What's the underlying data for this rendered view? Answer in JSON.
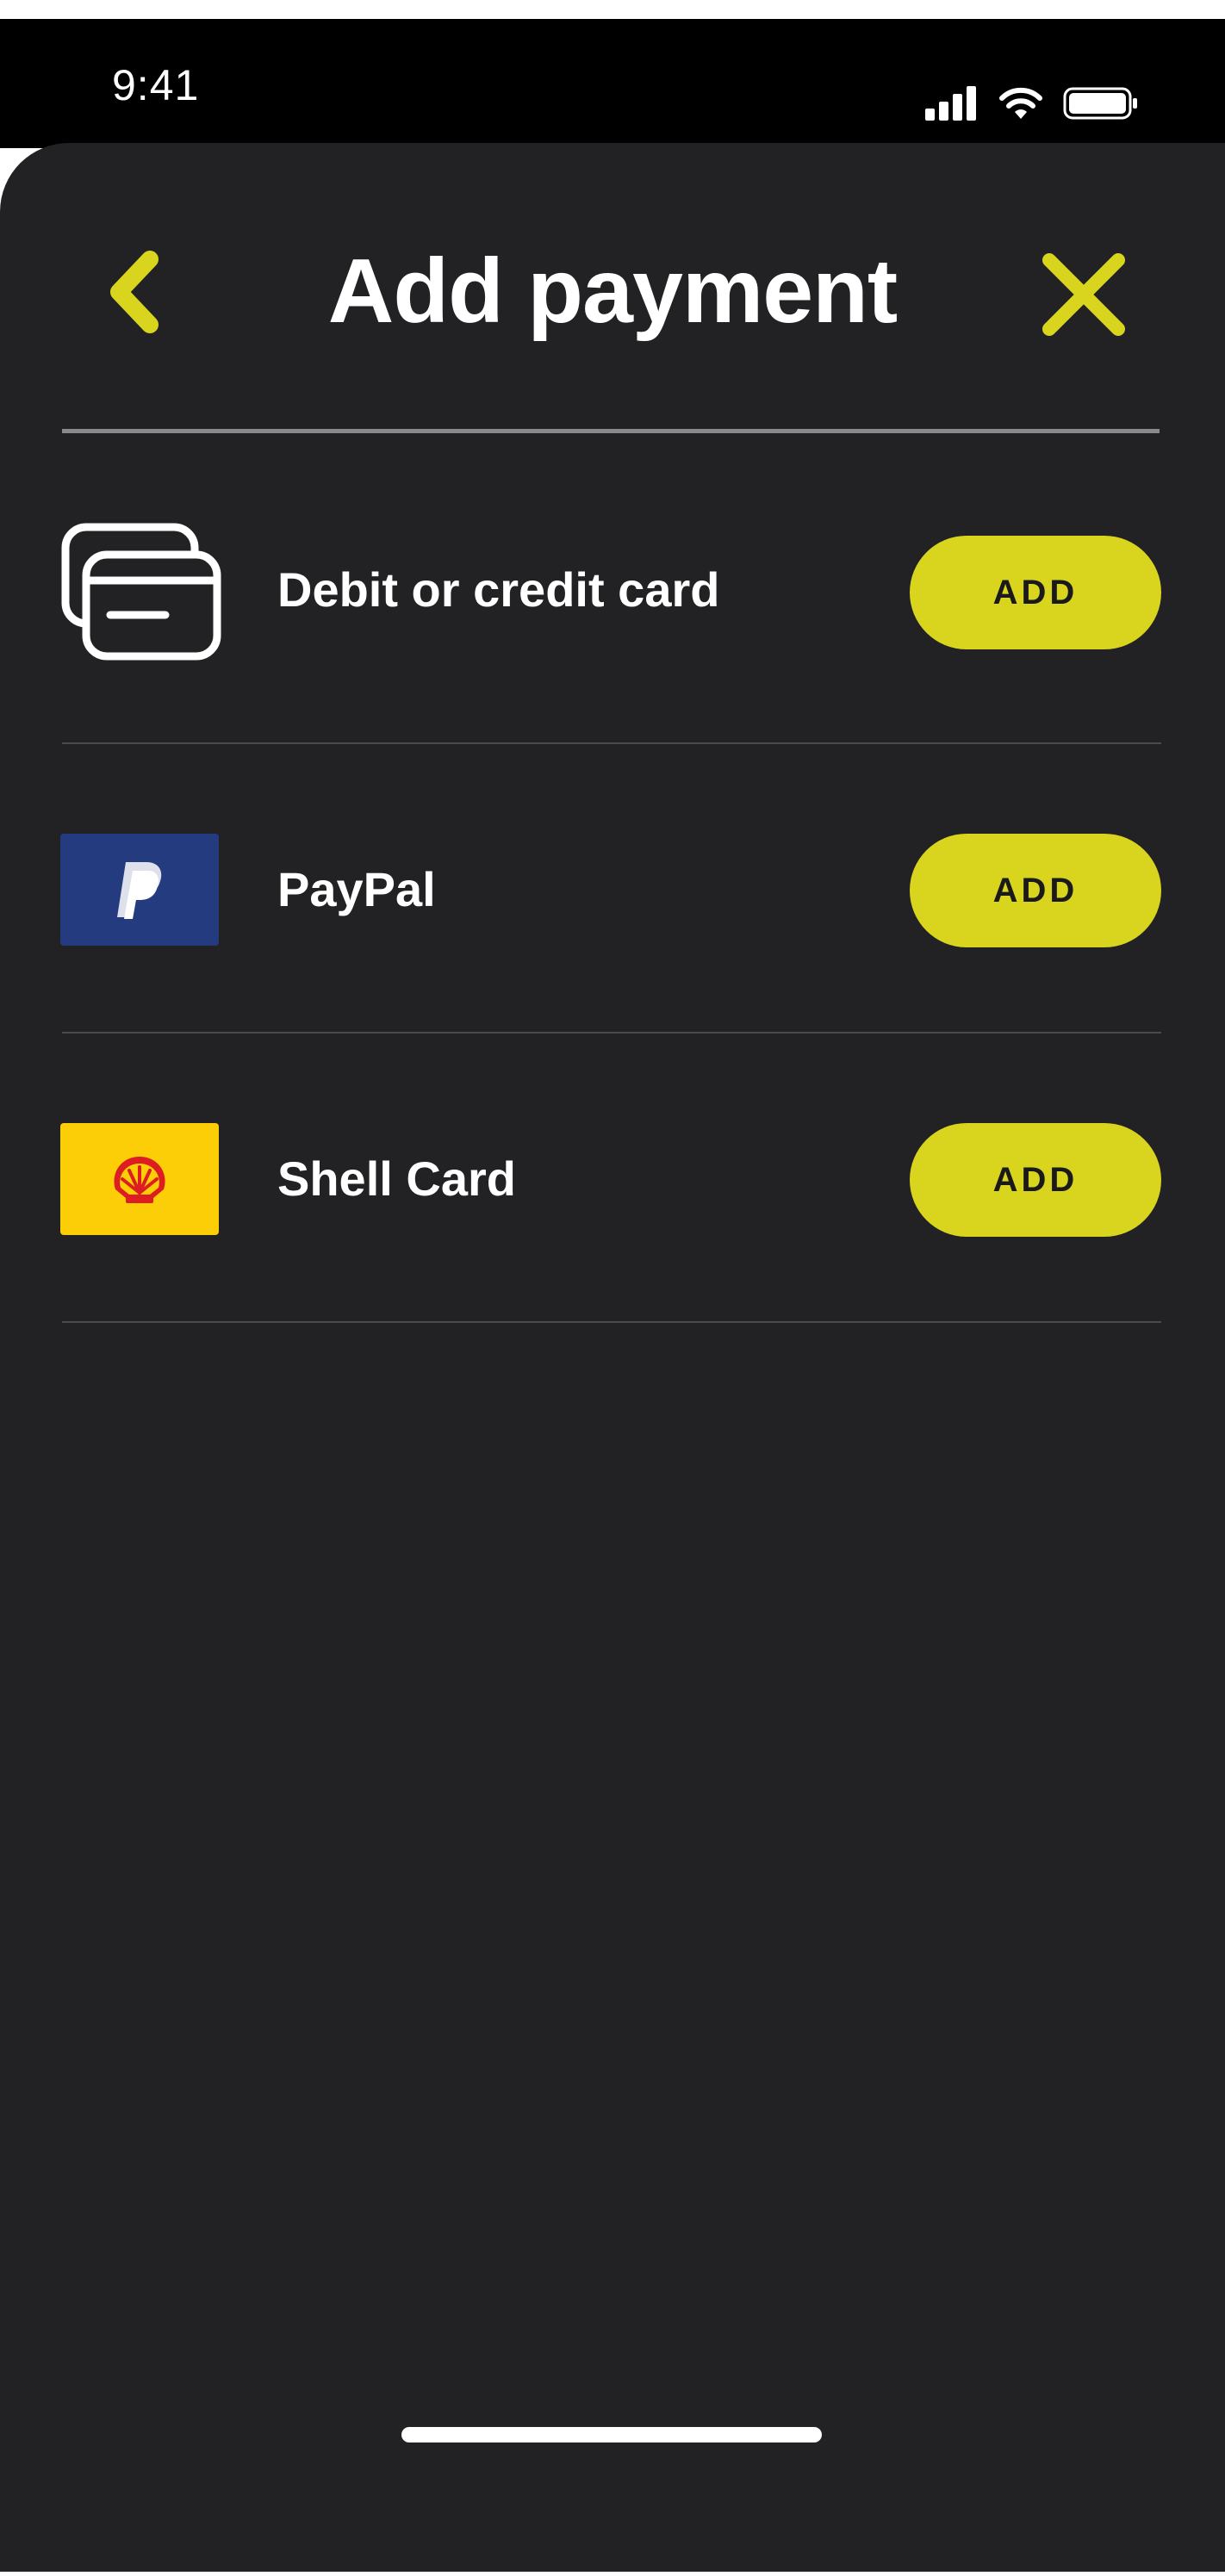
{
  "status_bar": {
    "time": "9:41",
    "icons": [
      "signal-icon",
      "wifi-icon",
      "battery-icon"
    ]
  },
  "header": {
    "title": "Add payment",
    "back_icon": "chevron-left-icon",
    "close_icon": "close-icon"
  },
  "payment_methods": [
    {
      "label": "Debit or credit card",
      "icon": "credit-cards-icon",
      "button": "ADD"
    },
    {
      "label": "PayPal",
      "icon": "paypal-logo-icon",
      "button": "ADD"
    },
    {
      "label": "Shell Card",
      "icon": "shell-logo-icon",
      "button": "ADD"
    }
  ],
  "colors": {
    "accent": "#d9d51e",
    "background": "#222225",
    "status_bar": "#000000",
    "paypal_blue": "#253b80",
    "shell_yellow": "#fbce07",
    "shell_red": "#dd1d21"
  }
}
